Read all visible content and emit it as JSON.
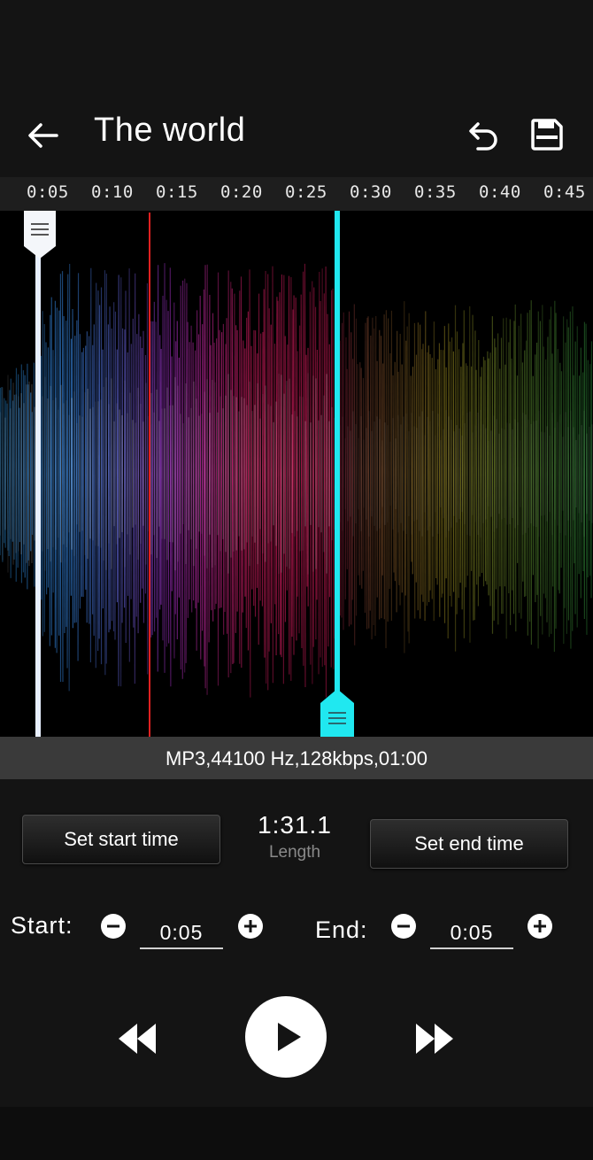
{
  "header": {
    "title": "The world",
    "back_icon": "arrow-left-icon",
    "undo_icon": "undo-icon",
    "save_icon": "save-icon"
  },
  "timeline": {
    "ticks": [
      "0:05",
      "0:10",
      "0:15",
      "0:20",
      "0:25",
      "0:30",
      "0:35",
      "0:40",
      "0:45"
    ]
  },
  "waveform": {
    "colors": {
      "start_segment": "#3a8ef0",
      "selected_segment": "#e8206a",
      "selected_alt": "#a030c8",
      "after_segment_1": "#9a8a20",
      "after_segment_2": "#2a8a3a",
      "start_handle": "#e8f0ff",
      "end_handle": "#20e8f0",
      "playhead": "#e02020"
    }
  },
  "info": {
    "text": "MP3,44100 Hz,128kbps,01:00"
  },
  "controls": {
    "set_start_label": "Set start time",
    "set_end_label": "Set end time",
    "length_value": "1:31.1",
    "length_label": "Length",
    "start_label": "Start:",
    "end_label": "End:",
    "start_value": "0:05",
    "end_value": "0:05"
  },
  "playback": {
    "rewind_icon": "rewind-icon",
    "play_icon": "play-icon",
    "forward_icon": "fast-forward-icon"
  }
}
